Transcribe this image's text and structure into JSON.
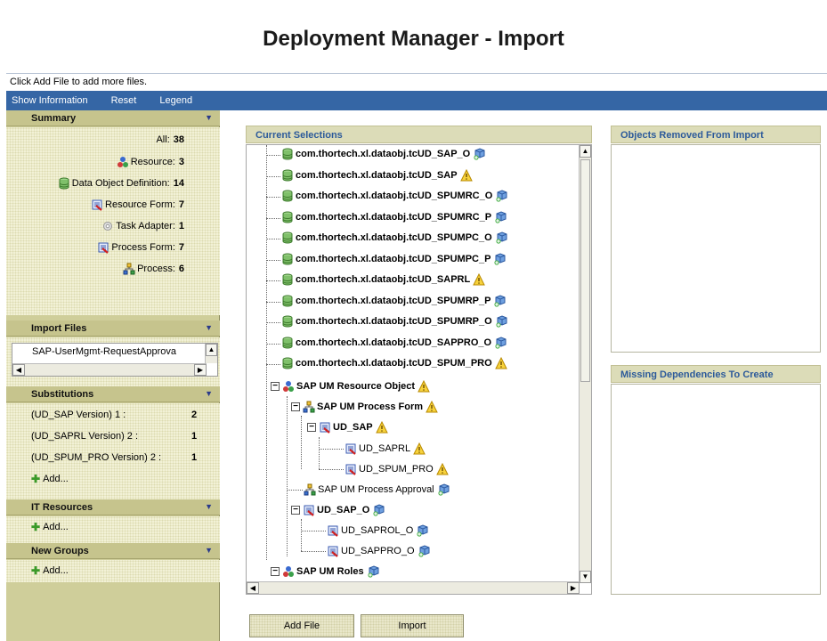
{
  "page": {
    "title": "Deployment Manager - Import",
    "hint": "Click Add File to add more files."
  },
  "menu": [
    "Show Information",
    "Reset",
    "Legend"
  ],
  "summary": {
    "header": "Summary",
    "all_label": "All:",
    "all_count": "38",
    "rows": [
      {
        "label": "Resource:",
        "count": "3",
        "icon": "resource-icon"
      },
      {
        "label": "Data Object Definition:",
        "count": "14",
        "icon": "database-icon"
      },
      {
        "label": "Resource Form:",
        "count": "7",
        "icon": "form-icon"
      },
      {
        "label": "Task Adapter:",
        "count": "1",
        "icon": "adapter-icon"
      },
      {
        "label": "Process Form:",
        "count": "7",
        "icon": "form-icon"
      },
      {
        "label": "Process:",
        "count": "6",
        "icon": "process-icon"
      }
    ]
  },
  "import_files": {
    "header": "Import Files",
    "file": "SAP-UserMgmt-RequestApprova"
  },
  "substitutions": {
    "header": "Substitutions",
    "rows": [
      {
        "label": "(UD_SAP Version) 1 :",
        "value": "2"
      },
      {
        "label": "(UD_SAPRL Version) 2 :",
        "value": "1"
      },
      {
        "label": "(UD_SPUM_PRO Version) 2 :",
        "value": "1"
      }
    ],
    "add": "Add..."
  },
  "it_resources": {
    "header": "IT Resources",
    "add": "Add..."
  },
  "new_groups": {
    "header": "New Groups",
    "add": "Add..."
  },
  "current_selections": {
    "header": "Current Selections",
    "items": [
      {
        "text": "com.thortech.xl.dataobj.tcUD_SAP_O",
        "badge": "cube"
      },
      {
        "text": "com.thortech.xl.dataobj.tcUD_SAP",
        "badge": "warn"
      },
      {
        "text": "com.thortech.xl.dataobj.tcUD_SPUMRC_O",
        "badge": "cube"
      },
      {
        "text": "com.thortech.xl.dataobj.tcUD_SPUMRC_P",
        "badge": "cube"
      },
      {
        "text": "com.thortech.xl.dataobj.tcUD_SPUMPC_O",
        "badge": "cube"
      },
      {
        "text": "com.thortech.xl.dataobj.tcUD_SPUMPC_P",
        "badge": "cube"
      },
      {
        "text": "com.thortech.xl.dataobj.tcUD_SAPRL",
        "badge": "warn"
      },
      {
        "text": "com.thortech.xl.dataobj.tcUD_SPUMRP_P",
        "badge": "cube"
      },
      {
        "text": "com.thortech.xl.dataobj.tcUD_SPUMRP_O",
        "badge": "cube"
      },
      {
        "text": "com.thortech.xl.dataobj.tcUD_SAPPRO_O",
        "badge": "cube"
      },
      {
        "text": "com.thortech.xl.dataobj.tcUD_SPUM_PRO",
        "badge": "warn"
      }
    ],
    "resource_object": "SAP UM Resource Object",
    "process_form": "SAP UM Process Form",
    "ud_sap": "UD_SAP",
    "ud_saprl": "UD_SAPRL",
    "ud_spum_pro": "UD_SPUM_PRO",
    "process_approval": "SAP UM Process Approval",
    "ud_sap_o": "UD_SAP_O",
    "ud_saprol_o": "UD_SAPROL_O",
    "ud_sappro_o": "UD_SAPPRO_O",
    "roles": "SAP UM Roles"
  },
  "removed_panel": {
    "header": "Objects Removed From Import"
  },
  "missing_panel": {
    "header": "Missing Dependencies To Create"
  },
  "buttons": {
    "add_file": "Add File",
    "import": "Import"
  },
  "colors": {
    "menubar": "#3566a5",
    "sidebar": "#cfce9a",
    "panel_title": "#2c5a9a"
  }
}
